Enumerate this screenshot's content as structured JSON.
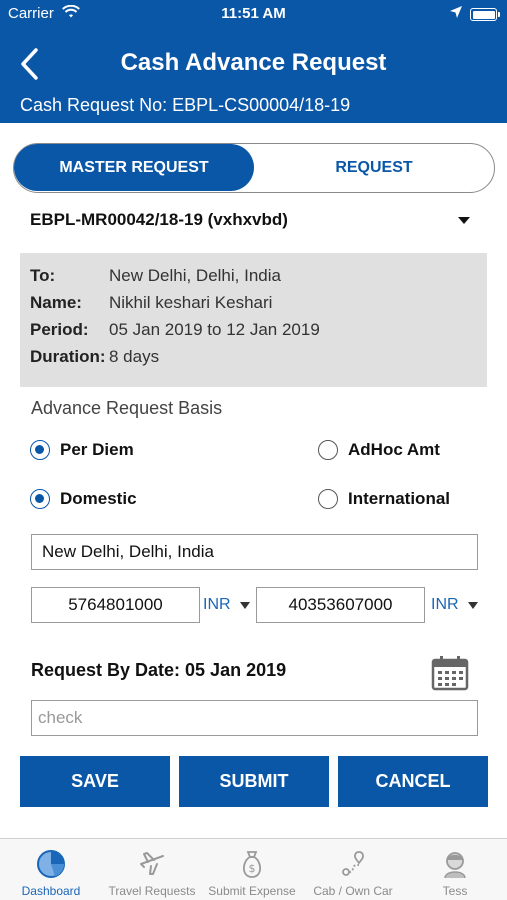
{
  "status_bar": {
    "carrier": "Carrier",
    "time": "11:51 AM"
  },
  "header": {
    "title": "Cash Advance Request",
    "request_no": "Cash Request No: EBPL-CS00004/18-19"
  },
  "toggle": {
    "master_label": "MASTER REQUEST",
    "request_label": "REQUEST"
  },
  "master_select": {
    "value": "EBPL-MR00042/18-19 (vxhxvbd)"
  },
  "info": {
    "to_label": "To:",
    "to_value": "New Delhi, Delhi, India",
    "name_label": "Name:",
    "name_value": "Nikhil keshari Keshari",
    "period_label": "Period:",
    "period_value": "05 Jan 2019 to 12 Jan 2019",
    "duration_label": "Duration:",
    "duration_value": "8 days"
  },
  "basis": {
    "title": "Advance Request Basis",
    "per_diem": "Per Diem",
    "adhoc": "AdHoc Amt",
    "domestic": "Domestic",
    "international": "International",
    "selected_basis": "Per Diem",
    "selected_scope": "Domestic"
  },
  "location_field": {
    "value": "New Delhi, Delhi, India"
  },
  "amount1": {
    "value": "5764801000",
    "currency": "INR"
  },
  "amount2": {
    "value": "40353607000",
    "currency": "INR"
  },
  "request_by_date": "Request By Date: 05 Jan 2019",
  "remarks": {
    "placeholder": "check"
  },
  "buttons": {
    "save": "SAVE",
    "submit": "SUBMIT",
    "cancel": "CANCEL"
  },
  "tabs": [
    {
      "label": "Dashboard",
      "icon": "pie-chart-icon",
      "active": true
    },
    {
      "label": "Travel Requests",
      "icon": "airplane-icon",
      "active": false
    },
    {
      "label": "Submit Expense",
      "icon": "money-bag-icon",
      "active": false
    },
    {
      "label": "Cab / Own Car",
      "icon": "route-icon",
      "active": false
    },
    {
      "label": "Tess",
      "icon": "assistant-icon",
      "active": false
    }
  ],
  "colors": {
    "primary": "#0a57a8",
    "info_bg": "#e0e0e0",
    "link": "#1a66b8"
  }
}
